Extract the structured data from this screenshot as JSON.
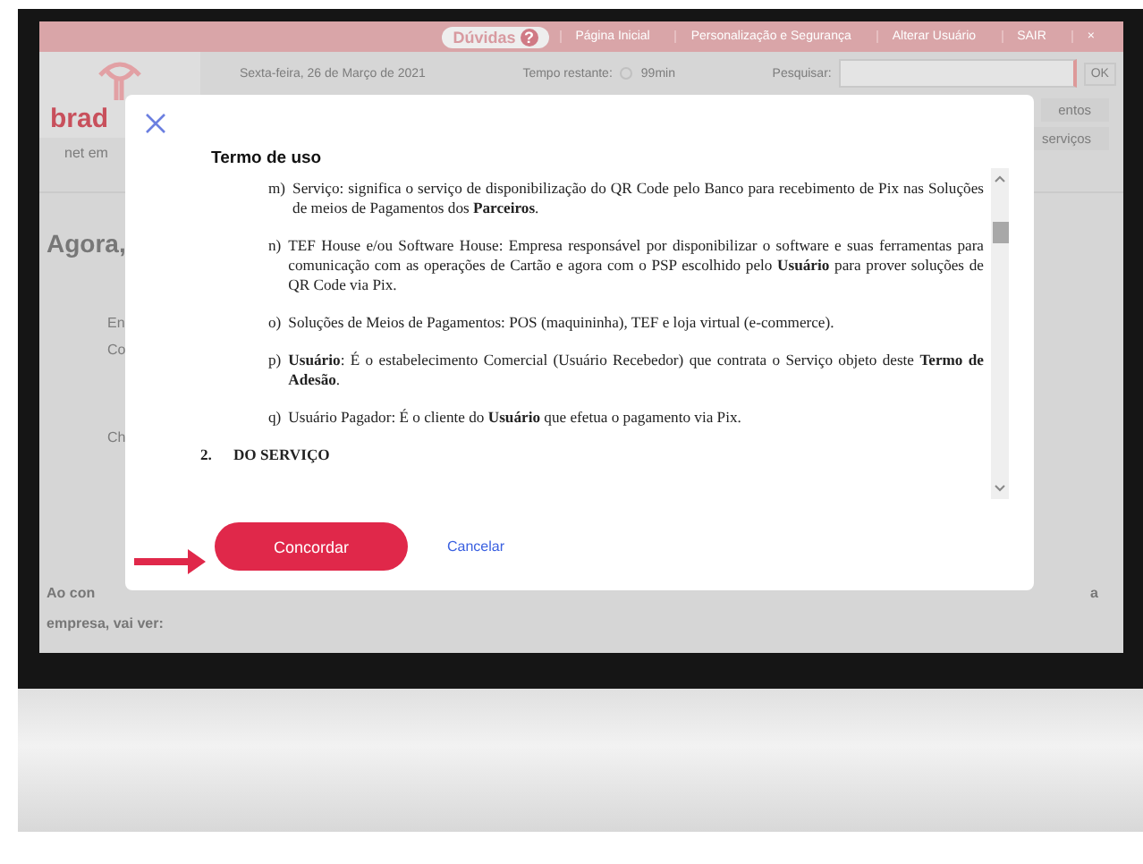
{
  "page": {
    "top_bar": {
      "help": "Dúvidas",
      "help_icon": "?",
      "links": [
        "Página Inicial",
        "Personalização e Segurança",
        "Alterar Usuário"
      ],
      "logout": "SAIR",
      "close": "×"
    },
    "info_bar": {
      "date": "Sexta-feira, 26 de Março de 2021",
      "timer_label": "Tempo restante:",
      "timer": "99min",
      "search_label": "Pesquisar:",
      "search_button": "OK"
    },
    "logo": "brad",
    "nav_left": "net em",
    "nav_right": [
      "entos",
      "serviços"
    ],
    "heading": "Agora,",
    "left_fragments": [
      "En",
      "Co",
      "Ch"
    ],
    "footer": [
      "Ao con",
      "empresa, vai ver:"
    ],
    "right_fragment": "a"
  },
  "dialog": {
    "title": "Termo de uso",
    "items": [
      {
        "marker": "m)",
        "text": "Serviço: significa o serviço de disponibilização do QR Code pelo Banco para recebimento de Pix nas Soluções de meios de Pagamentos dos **Parceiros**."
      },
      {
        "marker": "n)",
        "text": "TEF House e/ou Software House: Empresa responsável por disponibilizar o software e suas ferramentas para comunicação com as operações de Cartão e agora com o PSP escolhido pelo **Usuário** para prover soluções de QR Code via Pix."
      },
      {
        "marker": "o)",
        "text": "Soluções de Meios de Pagamentos: POS (maquininha), TEF e loja virtual (e-commerce)."
      },
      {
        "marker": "p)",
        "text": "**Usuário**: É o estabelecimento Comercial (Usuário Recebedor) que contrata o Serviço objeto deste **Termo de Adesão**."
      },
      {
        "marker": "q)",
        "text": "Usuário Pagador: É o cliente do **Usuário** que efetua o pagamento via Pix."
      }
    ],
    "section": {
      "number": "2.",
      "title": "DO SERVIÇO"
    },
    "primary_button": "Concordar",
    "secondary_button": "Cancelar"
  }
}
